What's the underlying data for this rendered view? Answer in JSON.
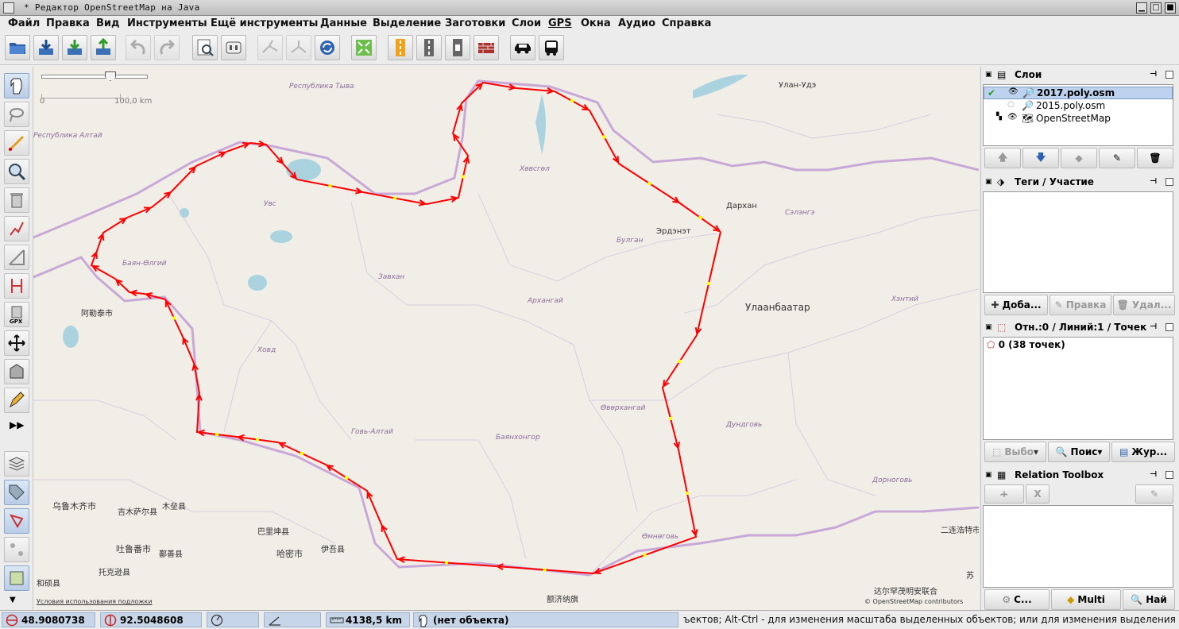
{
  "window": {
    "title": "* Редактор OpenStreetMap на Java"
  },
  "menu": [
    "Файл",
    "Правка",
    "Вид",
    "Инструменты",
    "Ещё инструменты",
    "Данные",
    "Выделение",
    "Заготовки",
    "Слои",
    "GPS",
    "Окна",
    "Аудио",
    "Справка"
  ],
  "toolbar": {
    "icons": [
      "open-icon",
      "download-icon",
      "download-green-icon",
      "upload-icon",
      "undo-icon",
      "redo-icon",
      "zoom-preview-icon",
      "preferences-icon",
      "split-way-icon",
      "combine-icon",
      "refresh-icon",
      "zoom-fit-icon",
      "road-orange-icon",
      "road-grey-icon",
      "traffic-signal-icon",
      "wall-icon",
      "car-icon",
      "bus-icon"
    ]
  },
  "map": {
    "scale_left": "0",
    "scale_right": "100,0 km",
    "terms_link": "Условия использования подложки",
    "attribution": "© OpenStreetMap contributors",
    "regions": [
      "Республика Тыва",
      "Республика Алтай",
      "Увс",
      "Хөвсгөл",
      "Баян-Өлгий",
      "Завхан",
      "Архангай",
      "Булган",
      "Сэлэнгэ",
      "Ховд",
      "Хэнтий",
      "Өвөрхангай",
      "Говь-Алтай",
      "Баянхонгор",
      "Дундговь",
      "Дорноговь",
      "Өмнөговь"
    ],
    "cities": [
      "Улан-Удэ",
      "Дархан",
      "Эрдэнэт",
      "Улаанбаатар",
      "阿勒泰市",
      "乌鲁木齐市",
      "吉木萨尔县",
      "木垒县",
      "巴里坤县",
      "吐鲁番市",
      "鄯善县",
      "哈密市",
      "伊吾县",
      "托克逊县",
      "和硕县",
      "额济纳旗",
      "二连浩特市",
      "达尔罕茂明安联合",
      "苏"
    ],
    "colors": {
      "route": "#ff0000",
      "midpoint": "#ffff00",
      "border": "#c9a8d8",
      "background": "#f1eee8",
      "water": "#aad3df"
    }
  },
  "panels": {
    "layers": {
      "title": "Слои",
      "items": [
        "2017.poly.osm",
        "2015.poly.osm",
        "OpenStreetMap"
      ],
      "selected": "2017.poly.osm"
    },
    "tags": {
      "title": "Теги / Участие",
      "buttons": [
        "Доба...",
        "Правка",
        "Удал..."
      ]
    },
    "selection": {
      "title": "Отн.:0 / Линий:1 / Точек:",
      "item": "0 (38 точек)",
      "buttons": [
        "Выбо",
        "Поис",
        "Жур..."
      ]
    },
    "relation_toolbox": {
      "title": "Relation Toolbox",
      "buttons": [
        "C...",
        "Multi",
        "Най"
      ]
    }
  },
  "status": {
    "lat": "48.9080738",
    "lon": "92.5048608",
    "distance": "4138,5 km",
    "object": "(нет объекта)",
    "help": "ъектов; Alt-Ctrl - для изменения масштаба выделенных объектов; или для изменения выделения"
  }
}
